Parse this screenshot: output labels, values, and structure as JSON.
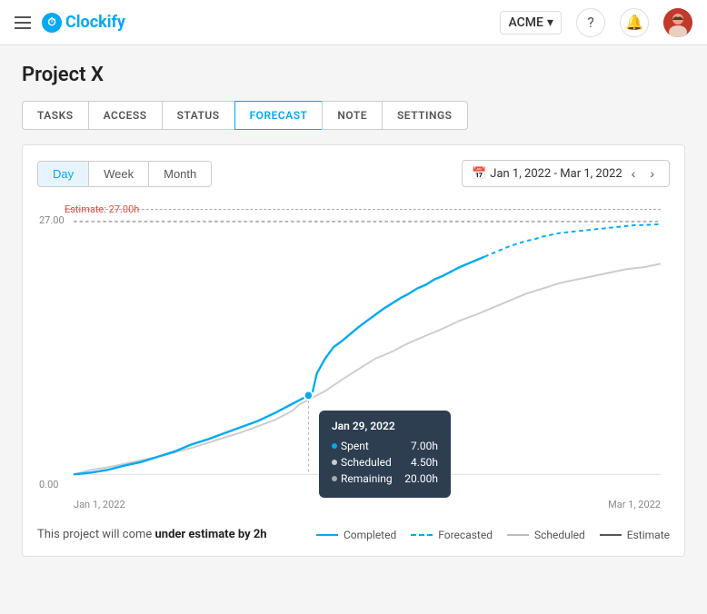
{
  "header": {
    "company": "ACME",
    "logo_text": "Clockify"
  },
  "page": {
    "title": "Project X"
  },
  "tabs": [
    {
      "label": "TASKS",
      "active": false
    },
    {
      "label": "ACCESS",
      "active": false
    },
    {
      "label": "STATUS",
      "active": false
    },
    {
      "label": "FORECAST",
      "active": true
    },
    {
      "label": "NOTE",
      "active": false
    },
    {
      "label": "SETTINGS",
      "active": false
    }
  ],
  "chart": {
    "view_day": "Day",
    "view_week": "Week",
    "view_month": "Month",
    "active_view": "Day",
    "date_range": "Jan 1, 2022 - Mar 1, 2022",
    "estimate_label": "Estimate: 27.00h",
    "y_max": "27.00",
    "y_min": "0.00",
    "x_start": "Jan 1, 2022",
    "x_end": "Mar 1, 2022"
  },
  "tooltip": {
    "date": "Jan 29, 2022",
    "spent_label": "Spent",
    "spent_value": "7.00h",
    "scheduled_label": "Scheduled",
    "scheduled_value": "4.50h",
    "remaining_label": "Remaining",
    "remaining_value": "20.00h"
  },
  "legend": [
    {
      "label": "Completed",
      "type": "solid-blue"
    },
    {
      "label": "Forecasted",
      "type": "dashed-blue"
    },
    {
      "label": "Scheduled",
      "type": "solid-gray"
    },
    {
      "label": "Estimate",
      "type": "solid-dark"
    }
  ],
  "footer": {
    "text_prefix": "This project will come",
    "highlight": "under estimate by 2h"
  }
}
